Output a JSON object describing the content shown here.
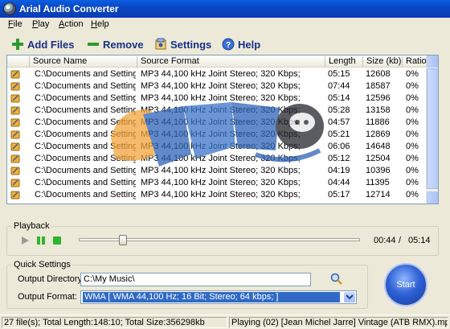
{
  "window": {
    "title": "Arial Audio Converter"
  },
  "menu": [
    "File",
    "Play",
    "Action",
    "Help"
  ],
  "toolbar": {
    "add_files": "Add Files",
    "remove": "Remove",
    "settings": "Settings",
    "help": "Help"
  },
  "columns": [
    "Source Name",
    "Source Format",
    "Length",
    "Size (kb)",
    "Ratio"
  ],
  "rows": [
    {
      "name": "C:\\Documents and Setting...",
      "format": "MP3  44,100 kHz Joint Stereo;  320 Kbps;",
      "length": "05:15",
      "size": "12608",
      "ratio": "0%"
    },
    {
      "name": "C:\\Documents and Setting...",
      "format": "MP3  44,100 kHz Joint Stereo;  320 Kbps;",
      "length": "07:44",
      "size": "18587",
      "ratio": "0%"
    },
    {
      "name": "C:\\Documents and Setting...",
      "format": "MP3  44,100 kHz Joint Stereo;  320 Kbps;",
      "length": "05:14",
      "size": "12596",
      "ratio": "0%"
    },
    {
      "name": "C:\\Documents and Setting...",
      "format": "MP3  44,100 kHz Joint Stereo;  320 Kbps;",
      "length": "05:28",
      "size": "13158",
      "ratio": "0%"
    },
    {
      "name": "C:\\Documents and Setting...",
      "format": "MP3  44,100 kHz Joint Stereo;  320 Kbps;",
      "length": "04:57",
      "size": "11886",
      "ratio": "0%"
    },
    {
      "name": "C:\\Documents and Setting...",
      "format": "MP3  44,100 kHz Joint Stereo;  320 Kbps;",
      "length": "05:21",
      "size": "12869",
      "ratio": "0%"
    },
    {
      "name": "C:\\Documents and Setting...",
      "format": "MP3  44,100 kHz Joint Stereo;  320 Kbps;",
      "length": "06:06",
      "size": "14648",
      "ratio": "0%"
    },
    {
      "name": "C:\\Documents and Setting...",
      "format": "MP3  44,100 kHz Joint Stereo;  320 Kbps;",
      "length": "05:12",
      "size": "12504",
      "ratio": "0%"
    },
    {
      "name": "C:\\Documents and Setting...",
      "format": "MP3  44,100 kHz Joint Stereo;  320 Kbps;",
      "length": "04:19",
      "size": "10396",
      "ratio": "0%"
    },
    {
      "name": "C:\\Documents and Setting...",
      "format": "MP3  44,100 kHz Joint Stereo;  320 Kbps;",
      "length": "04:44",
      "size": "11395",
      "ratio": "0%"
    },
    {
      "name": "C:\\Documents and Setting...",
      "format": "MP3  44,100 kHz Joint Stereo;  320 Kbps;",
      "length": "05:17",
      "size": "12714",
      "ratio": "0%"
    }
  ],
  "playback": {
    "label": "Playback",
    "position_fraction": 0.15,
    "current_time": "00:44",
    "separator": "/",
    "total_time": "05:14"
  },
  "quick_settings": {
    "label": "Quick Settings",
    "output_directory_label": "Output Directory",
    "output_directory": "C:\\My Music\\",
    "output_format_label": "Output Format:",
    "output_format": "WMA  [ WMA 44,100 Hz; 16 Bit; Stereo; 64 kbps; ]"
  },
  "start_button": "Start",
  "status": {
    "summary": "27 file(s); Total Length:148:10; Total Size:356298kb",
    "playing": "Playing (02) [Jean Michel Jarre] Vintage (ATB RMX).mp3"
  },
  "icons": [
    "app-icon",
    "add-icon",
    "remove-icon",
    "settings-icon",
    "help-icon",
    "audio-file-icon",
    "play-icon",
    "pause-icon",
    "stop-icon",
    "browse-folder-icon",
    "dropdown-arrow-icon"
  ],
  "colors": {
    "toolbar_text": "#183088",
    "selection": "#316ac5",
    "titlebar": "#0a48c8"
  }
}
